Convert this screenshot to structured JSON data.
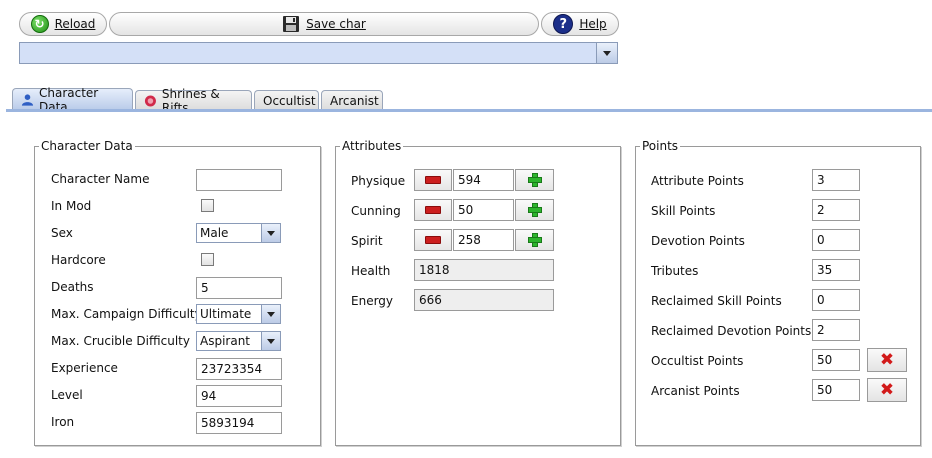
{
  "toolbar": {
    "reload_label": "Reload",
    "save_label": "Save char",
    "help_label": "Help"
  },
  "character_select": {
    "value": ""
  },
  "tabs": [
    {
      "label": "Character Data",
      "icon": "character-icon",
      "active": true
    },
    {
      "label": "Shrines & Rifts",
      "icon": "shrine-icon",
      "active": false
    },
    {
      "label": "Occultist",
      "active": false
    },
    {
      "label": "Arcanist",
      "active": false
    }
  ],
  "character_panel": {
    "title": "Character Data",
    "name_label": "Character Name",
    "name_value": "",
    "in_mod_label": "In Mod",
    "in_mod_checked": false,
    "sex_label": "Sex",
    "sex_value": "Male",
    "hardcore_label": "Hardcore",
    "hardcore_checked": false,
    "deaths_label": "Deaths",
    "deaths_value": "5",
    "campaign_label": "Max. Campaign Difficulty",
    "campaign_value": "Ultimate",
    "crucible_label": "Max. Crucible Difficulty",
    "crucible_value": "Aspirant",
    "experience_label": "Experience",
    "experience_value": "23723354",
    "level_label": "Level",
    "level_value": "94",
    "iron_label": "Iron",
    "iron_value": "5893194"
  },
  "attributes_panel": {
    "title": "Attributes",
    "physique_label": "Physique",
    "physique_value": "594",
    "cunning_label": "Cunning",
    "cunning_value": "50",
    "spirit_label": "Spirit",
    "spirit_value": "258",
    "health_label": "Health",
    "health_value": "1818",
    "energy_label": "Energy",
    "energy_value": "666"
  },
  "points_panel": {
    "title": "Points",
    "attribute_label": "Attribute Points",
    "attribute_value": "3",
    "skill_label": "Skill Points",
    "skill_value": "2",
    "devotion_label": "Devotion Points",
    "devotion_value": "0",
    "tributes_label": "Tributes",
    "tributes_value": "35",
    "reclaimed_skill_label": "Reclaimed Skill Points",
    "reclaimed_skill_value": "0",
    "reclaimed_devotion_label": "Reclaimed Devotion Points",
    "reclaimed_devotion_value": "2",
    "occultist_label": "Occultist Points",
    "occultist_value": "50",
    "arcanist_label": "Arcanist Points",
    "arcanist_value": "50"
  },
  "colors": {
    "tab_accent": "#9bb5df",
    "combo_bg": "#d4e0f7",
    "remove_red": "#d21a1a",
    "add_green": "#2db52d"
  }
}
